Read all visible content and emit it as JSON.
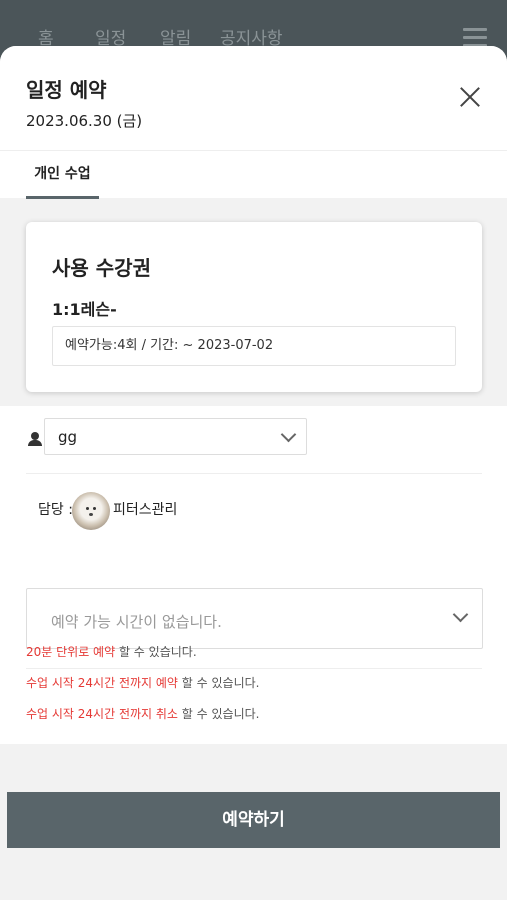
{
  "nav": {
    "items": [
      "홈",
      "일정",
      "알림",
      "공지사항"
    ]
  },
  "modal": {
    "title": "일정 예약",
    "date": "2023.06.30 (금)"
  },
  "tabs": [
    {
      "label": "개인 수업"
    }
  ],
  "ticket": {
    "section_title": "사용 수강권",
    "name": "1:1레슨-",
    "detail": "예약가능:4회 / 기간: ~ 2023-07-02"
  },
  "member": {
    "selected": "gg"
  },
  "manager": {
    "label": "담당 :",
    "name": "피터스관리"
  },
  "time_select": {
    "placeholder": "예약 가능 시간이 없습니다."
  },
  "notes": [
    {
      "highlight": "20분 단위로 예약",
      "rest": " 할 수 있습니다."
    },
    {
      "highlight": "수업 시작 24시간 전까지 예약",
      "rest": " 할 수 있습니다."
    },
    {
      "highlight": "수업 시작 24시간 전까지 취소",
      "rest": " 할 수 있습니다."
    }
  ],
  "submit": {
    "label": "예약하기"
  },
  "colors": {
    "accent": "#59656a",
    "highlight": "#e53935"
  }
}
